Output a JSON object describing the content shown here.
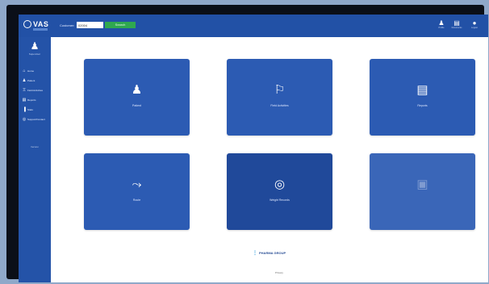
{
  "app": {
    "logo_text": "VAS",
    "customer_label": "Customer:",
    "customer_value": "02004",
    "go_label": "Search"
  },
  "top_tools": [
    {
      "icon": "user-icon",
      "glyph": "♟",
      "label": "Profile"
    },
    {
      "icon": "document-icon",
      "glyph": "▤",
      "label": "Documents"
    },
    {
      "icon": "account-icon",
      "glyph": "●",
      "label": "Logout"
    }
  ],
  "sidebar": {
    "user_name": "Supervisor",
    "items": [
      {
        "icon": "home-icon",
        "glyph": "⌂",
        "label": "Home"
      },
      {
        "icon": "person-icon",
        "glyph": "♟",
        "label": "Patient"
      },
      {
        "icon": "group-icon",
        "glyph": "♖",
        "label": "Field Activities"
      },
      {
        "icon": "document-icon",
        "glyph": "▤",
        "label": "Reports"
      },
      {
        "icon": "chart-icon",
        "glyph": "▐",
        "label": "Stats"
      },
      {
        "icon": "support-icon",
        "glyph": "◎",
        "label": "Support/Contact"
      }
    ],
    "footer": "Version"
  },
  "tiles": [
    {
      "name": "tile-patient",
      "icon": "person-icon",
      "glyph": "♟",
      "label": "Patient"
    },
    {
      "name": "tile-field-activities",
      "icon": "map-pin-icon",
      "glyph": "⚐",
      "label": "Field Activities"
    },
    {
      "name": "tile-reports",
      "icon": "document-icon",
      "glyph": "▤",
      "label": "Reports"
    },
    {
      "name": "tile-route",
      "icon": "route-icon",
      "glyph": "⤳",
      "label": "Route"
    },
    {
      "name": "tile-weight-records",
      "icon": "scale-icon",
      "glyph": "◎",
      "label": "Weight Records"
    },
    {
      "name": "tile-disabled",
      "icon": "lock-icon",
      "glyph": "▣",
      "label": ""
    }
  ],
  "footer": {
    "brand": "PHARMA GROUP",
    "link": "Privacy"
  },
  "colors": {
    "primary": "#2453a8",
    "tile": "#2c5bb3",
    "accent_green": "#2fa84f"
  }
}
